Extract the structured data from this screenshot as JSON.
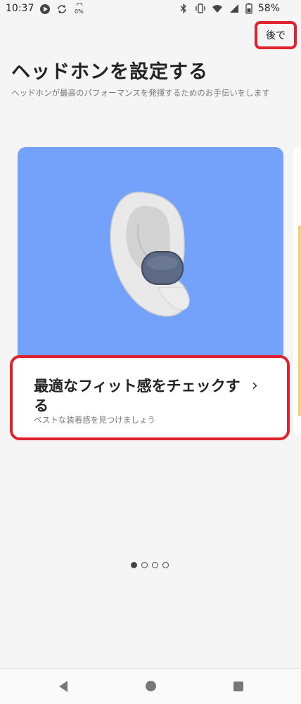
{
  "status_bar": {
    "time": "10:37",
    "network_speed": "0%",
    "battery": "58%"
  },
  "header": {
    "later_label": "後で",
    "title": "ヘッドホンを設定する",
    "subtitle": "ヘッドホンが最高のパフォーマンスを発揮するためのお手伝いをします"
  },
  "card": {
    "title": "最適なフィット感をチェックする",
    "description": "ベストな装着感を見つけましょう",
    "illustration_bg": "#74a2fb"
  },
  "pager": {
    "total": 4,
    "active_index": 0
  },
  "nav": {
    "back_icon": "back-triangle-icon",
    "home_icon": "home-circle-icon",
    "recents_icon": "recents-square-icon"
  },
  "colors": {
    "highlight": "#e0222e",
    "accent_yellow": "#f5d46a"
  }
}
